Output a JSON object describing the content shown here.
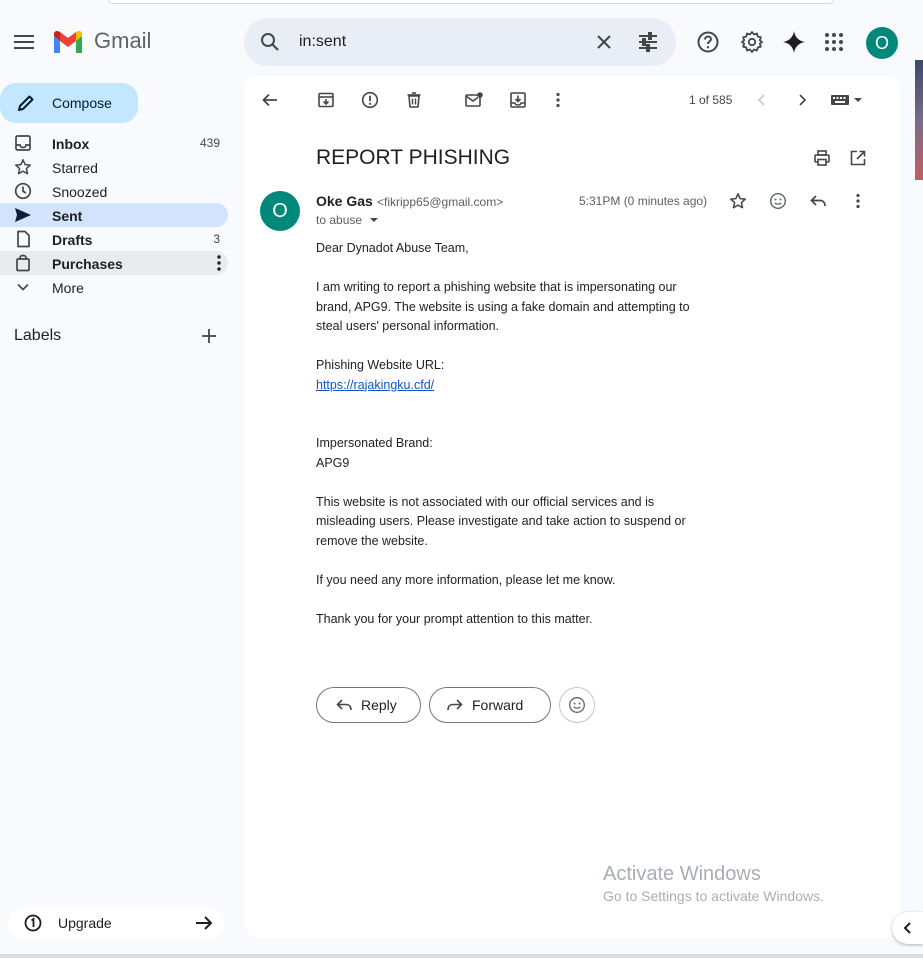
{
  "app": {
    "name": "Gmail"
  },
  "search": {
    "value": "in:sent"
  },
  "account": {
    "initial": "O"
  },
  "compose": {
    "label": "Compose"
  },
  "nav": [
    {
      "label": "Inbox",
      "count": "439",
      "bold": true,
      "icon": "inbox-icon"
    },
    {
      "label": "Starred",
      "count": "",
      "bold": false,
      "icon": "star-icon"
    },
    {
      "label": "Snoozed",
      "count": "",
      "bold": false,
      "icon": "clock-icon"
    },
    {
      "label": "Sent",
      "count": "",
      "bold": true,
      "icon": "send-icon"
    },
    {
      "label": "Drafts",
      "count": "3",
      "bold": true,
      "icon": "draft-icon"
    },
    {
      "label": "Purchases",
      "count": "",
      "bold": true,
      "icon": "shopping-bag-icon"
    },
    {
      "label": "More",
      "count": "",
      "bold": false,
      "icon": "chevron-down-icon"
    }
  ],
  "labels": {
    "heading": "Labels"
  },
  "upgrade": {
    "label": "Upgrade"
  },
  "pager": {
    "text": "1 of 585"
  },
  "email": {
    "subject": "REPORT PHISHING",
    "sender_initial": "O",
    "sender_name": "Oke Gas",
    "sender_email": "<fikripp65@gmail.com>",
    "to": "to abuse",
    "time": "5:31PM (0 minutes ago)",
    "greeting": "Dear Dynadot  Abuse Team,",
    "para1_l1": "I am writing to report a phishing website that is impersonating our",
    "para1_l2": "brand, APG9. The website is using a fake domain and attempting to",
    "para1_l3": "steal users' personal information.",
    "url_label": "Phishing Website URL:",
    "url": "https://rajakingku.cfd/",
    "brand_label": "Impersonated Brand:",
    "brand": "APG9",
    "para2_l1": "This website is not associated with our official services and is",
    "para2_l2": "misleading users. Please investigate and take action to suspend or",
    "para2_l3": "remove the website.",
    "para3": "If you need any more information, please let me know.",
    "para4": "Thank you for your prompt attention to this matter."
  },
  "actions": {
    "reply": "Reply",
    "forward": "Forward"
  },
  "watermark": {
    "line1": "Activate Windows",
    "line2": "Go to Settings to activate Windows."
  },
  "colors": {
    "accent": "#0b57d0",
    "avatar": "#00897b",
    "compose_bg": "#c2e7ff",
    "active_nav": "#d3e3fd"
  }
}
